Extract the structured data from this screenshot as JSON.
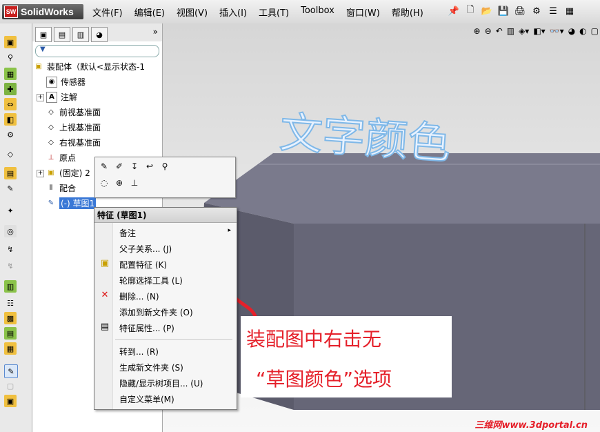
{
  "app": {
    "logo_text": "SolidWorks"
  },
  "menu": [
    "文件(F)",
    "编辑(E)",
    "视图(V)",
    "插入(I)",
    "工具(T)",
    "Toolbox",
    "窗口(W)",
    "帮助(H)"
  ],
  "tree": {
    "root": "装配体（默认<显示状态-1",
    "items": [
      "传感器",
      "注解",
      "前视基准面",
      "上视基准面",
      "右视基准面",
      "原点",
      "(固定) 2",
      "配合",
      "(-) 草图1"
    ]
  },
  "viewport": {
    "model_text": "文字颜色"
  },
  "context_menu": {
    "header": "特征 (草图1)",
    "items": [
      "备注",
      "父子关系... (J)",
      "配置特征 (K)",
      "轮廓选择工具 (L)",
      "删除... (N)",
      "添加到新文件夹 (O)",
      "特征属性... (P)",
      "转到... (R)",
      "生成新文件夹 (S)",
      "隐藏/显示树项目... (U)",
      "自定义菜单(M)"
    ]
  },
  "annotation": {
    "line1": "装配图中右击无",
    "line2": "“草图颜色”选项"
  },
  "watermark": "三维网www.3dportal.cn",
  "colors": {
    "annotation_red": "#e5202a",
    "model_text_blue": "#7fb8e8",
    "selected_item": "#3a78d6"
  }
}
